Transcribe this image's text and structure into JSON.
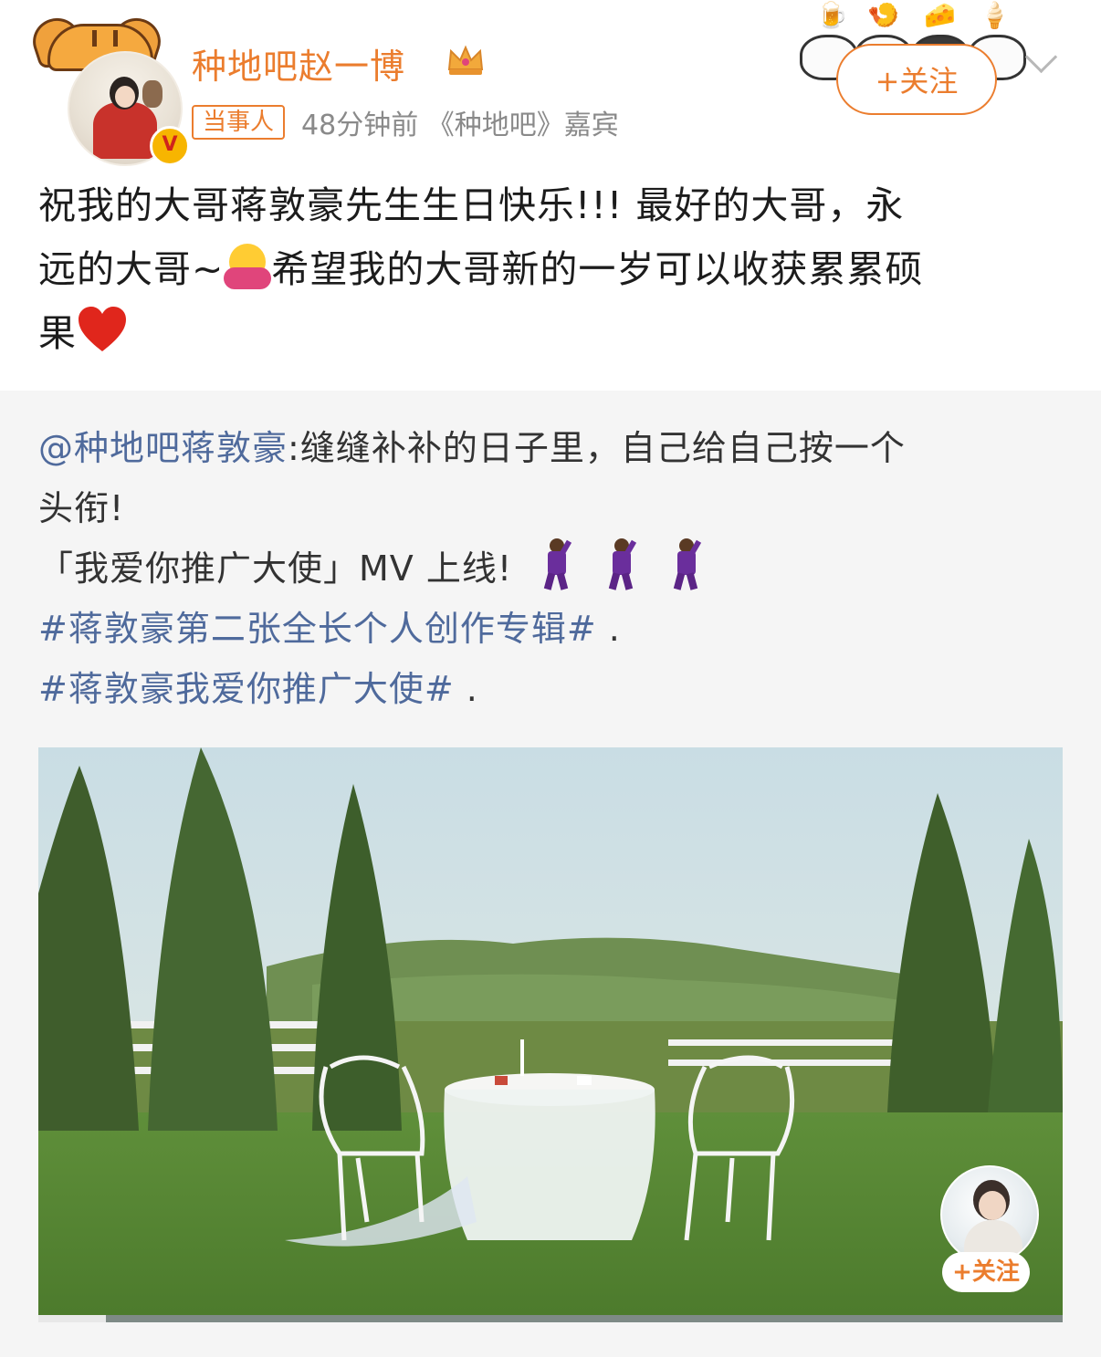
{
  "author": {
    "name": "种地吧赵一博",
    "tag": "当事人",
    "meta": "48分钟前 《种地吧》嘉宾",
    "verified_mark": "V"
  },
  "follow_label": "+关注",
  "post": {
    "line1": "祝我的大哥蒋敦豪先生生日快乐!!!  最好的大哥，永",
    "line2_a": "远的大哥~",
    "line2_b": "希望我的大哥新的一岁可以收获累累硕",
    "line3": "果"
  },
  "repost": {
    "mention": "@种地吧蒋敦豪",
    "text_a": ":缝缝补补的日子里，自己给自己按一个",
    "text_b": "头衔!",
    "text_c": "「我爱你推广大使」MV 上线!",
    "hashtag1": "#蒋敦豪第二张全长个人创作专辑#",
    "hashtag1_suffix": " .",
    "hashtag2": "#蒋敦豪我爱你推广大使#",
    "hashtag2_suffix": " ."
  },
  "video": {
    "pip_follow_label": "+关注",
    "progress": 0.066
  },
  "colors": {
    "brand_orange": "#eb7d2e",
    "link_blue": "#4f6a9c",
    "meta_gray": "#8a8a8a",
    "repost_bg": "#f5f5f5"
  },
  "icons": [
    "crown-icon",
    "verified-icon",
    "chevron-down-icon",
    "hug-emoji-icon",
    "heart-emoji-icon",
    "dancer-emoji-icon"
  ]
}
